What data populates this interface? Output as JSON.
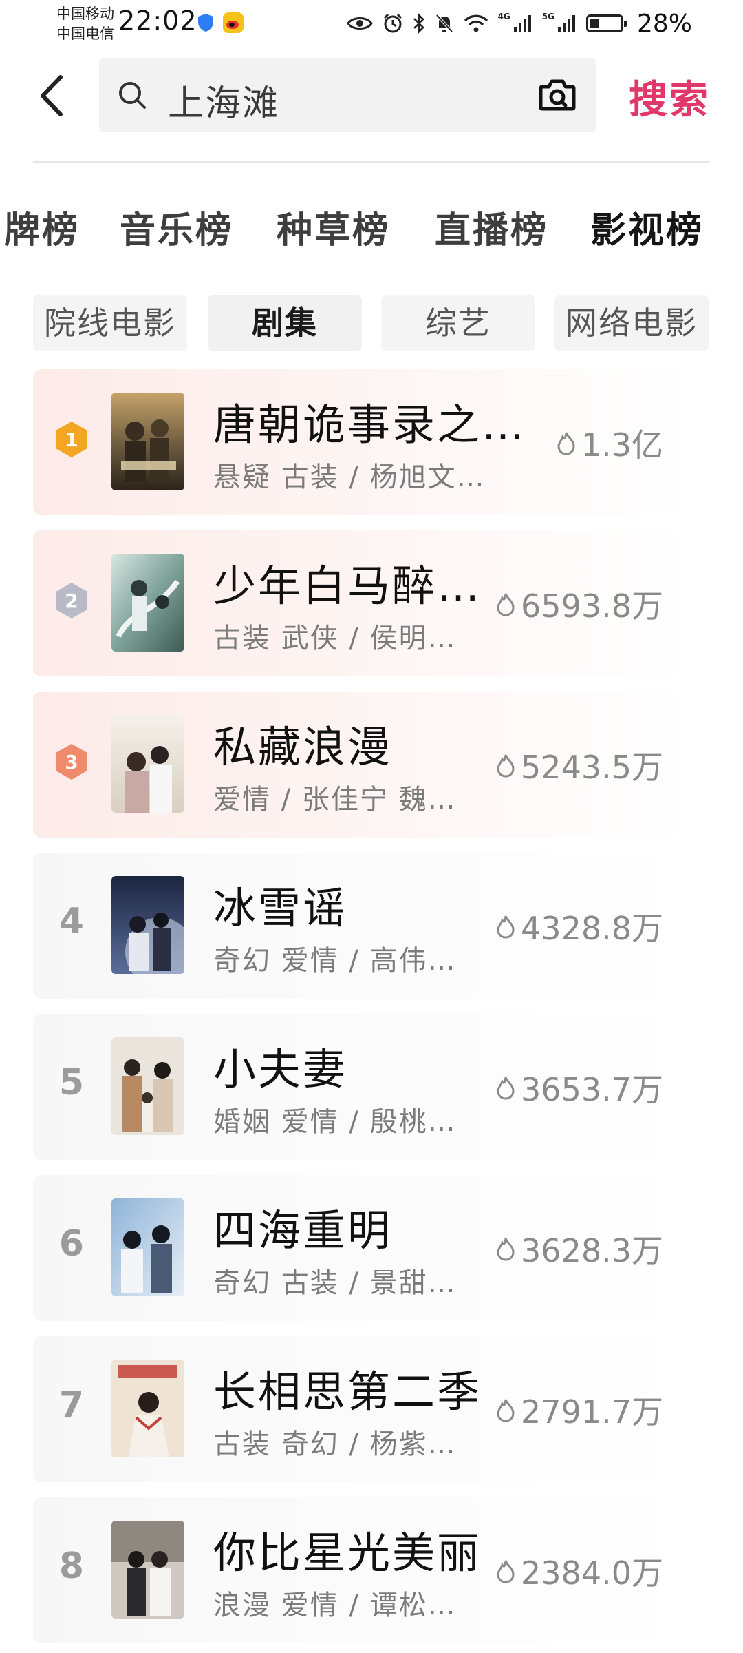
{
  "status_bar": {
    "carrier_1": "中国移动",
    "carrier_2": "中国电信",
    "time": "22:02",
    "net_1": "4G",
    "net_2": "5G",
    "battery_percent": "28%",
    "battery_level": 0.28
  },
  "search": {
    "query": "上海滩",
    "submit_label": "搜索"
  },
  "tabs": [
    {
      "label": "牌榜"
    },
    {
      "label": "音乐榜"
    },
    {
      "label": "种草榜"
    },
    {
      "label": "直播榜"
    },
    {
      "label": "影视榜"
    }
  ],
  "sub_tabs": [
    {
      "label": "院线电影"
    },
    {
      "label": "剧集"
    },
    {
      "label": "综艺"
    },
    {
      "label": "网络电影"
    }
  ],
  "colors": {
    "accent": "#e0386a",
    "gold": "#f3a623",
    "silver": "#b8bac8",
    "bronze": "#ef8a6a"
  },
  "ranking": [
    {
      "rank": "1",
      "title": "唐朝诡事录之…",
      "meta": "悬疑 古装 / 杨旭文…",
      "heat": "1.3亿"
    },
    {
      "rank": "2",
      "title": "少年白马醉…",
      "meta": "古装 武侠 / 侯明…",
      "heat": "6593.8万"
    },
    {
      "rank": "3",
      "title": "私藏浪漫",
      "meta": "爱情 / 张佳宁 魏…",
      "heat": "5243.5万"
    },
    {
      "rank": "4",
      "title": "冰雪谣",
      "meta": "奇幻 爱情 / 高伟…",
      "heat": "4328.8万"
    },
    {
      "rank": "5",
      "title": "小夫妻",
      "meta": "婚姻 爱情 / 殷桃…",
      "heat": "3653.7万"
    },
    {
      "rank": "6",
      "title": "四海重明",
      "meta": "奇幻 古装 / 景甜…",
      "heat": "3628.3万"
    },
    {
      "rank": "7",
      "title": "长相思第二季",
      "meta": "古装 奇幻 / 杨紫…",
      "heat": "2791.7万"
    },
    {
      "rank": "8",
      "title": "你比星光美丽",
      "meta": "浪漫 爱情 / 谭松…",
      "heat": "2384.0万"
    }
  ]
}
